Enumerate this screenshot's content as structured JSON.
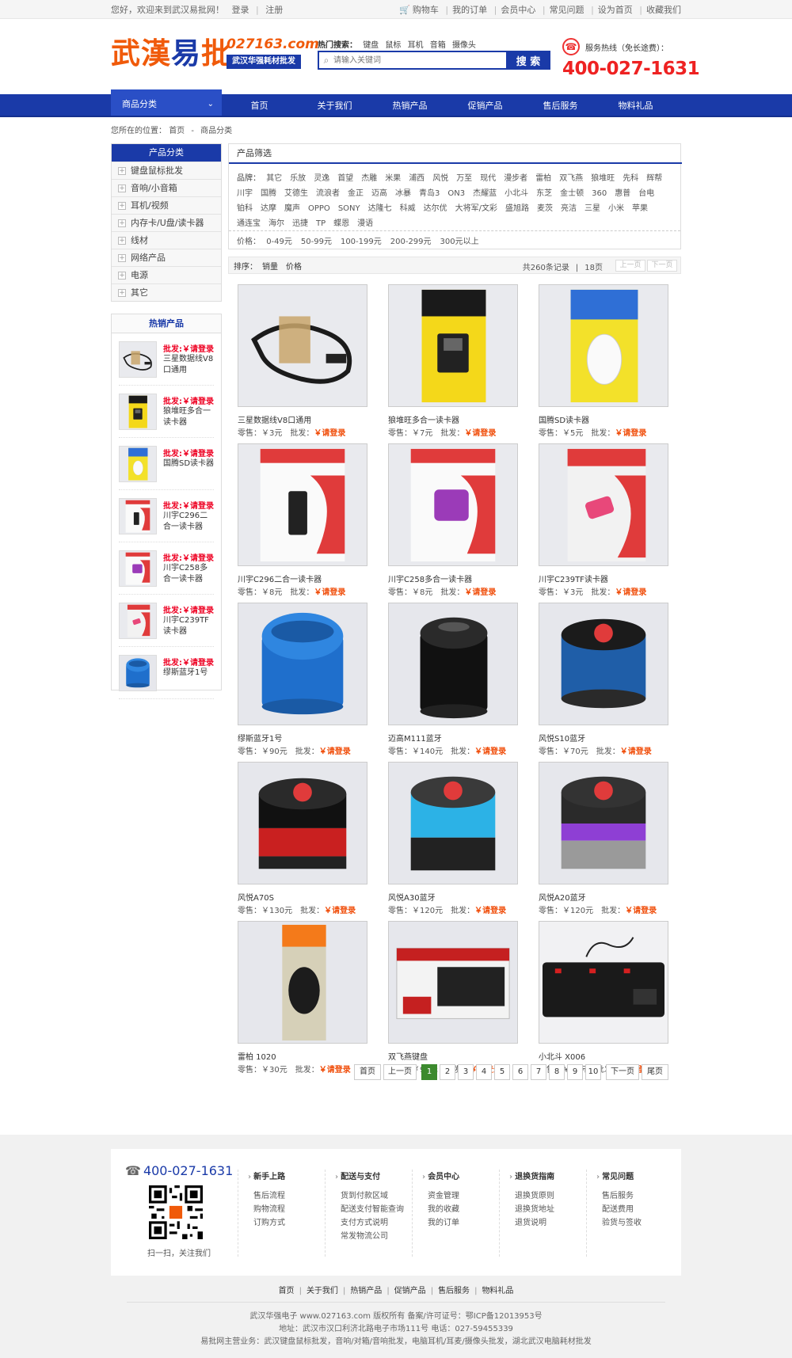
{
  "topbar": {
    "welcome": "您好，欢迎来到武汉易批网！",
    "login": "登录",
    "register": "注册",
    "links": [
      "购物车",
      "我的订单",
      "会员中心",
      "常见问题",
      "设为首页",
      "收藏我们"
    ]
  },
  "header": {
    "logo_text_a": "武漢",
    "logo_text_b": "易",
    "logo_text_c": "批",
    "logo_domain": "027163.com",
    "logo_sub": "武汉华强耗材批发",
    "hot_label": "热门搜索：",
    "hot_words": [
      "键盘",
      "鼠标",
      "耳机",
      "音箱",
      "摄像头"
    ],
    "search_placeholder": "请输入关键词",
    "search_button": "搜 索",
    "hotline_label": "服务热线（免长途费）：",
    "hotline_number": "400-027-1631"
  },
  "nav": {
    "category": "商品分类",
    "items": [
      "首页",
      "关于我们",
      "热销产品",
      "促销产品",
      "售后服务",
      "物料礼品"
    ]
  },
  "breadcrumb": {
    "label": "您所在的位置：",
    "home": "首页",
    "current": "商品分类"
  },
  "sidebar": {
    "title": "产品分类",
    "categories": [
      "键盘鼠标批发",
      "音响/小音箱",
      "耳机/视频",
      "内存卡/U盘/读卡器",
      "线材",
      "网络产品",
      "电源",
      "其它"
    ],
    "hot_title": "热销产品",
    "hot_price": "批发:￥请登录",
    "hot_items": [
      "三星数据线V8口通用",
      "狼堆旺多合一读卡器",
      "国腾SD读卡器",
      "川宇C296二合一读卡器",
      "川宇C258多合一读卡器",
      "川宇C239TF读卡器",
      "缪斯蓝牙1号"
    ]
  },
  "filter": {
    "title": "产品筛选",
    "brand_label": "品牌：",
    "brands": [
      "其它",
      "乐放",
      "灵逸",
      "首望",
      "杰雕",
      "米果",
      "浦西",
      "风悦",
      "万至",
      "现代",
      "漫步者",
      "雷柏",
      "双飞燕",
      "狼堆旺",
      "先科",
      "辉帮",
      "川宇",
      "国腾",
      "艾德生",
      "流浪者",
      "金正",
      "迈高",
      "冰暴",
      "青岛3",
      "ON3",
      "杰耀蓝",
      "小北斗",
      "东芝",
      "金士顿",
      "360",
      "惠普",
      "台电",
      "铂科",
      "达摩",
      "魔声",
      "OPPO",
      "SONY",
      "达隆七",
      "科威",
      "达尔优",
      "大将军/文彩",
      "盛旭路",
      "麦茨",
      "亮洁",
      "三星",
      "小米",
      "苹果",
      "通连宝",
      "海尔",
      "迅捷",
      "TP",
      "蝶恩",
      "漫语"
    ],
    "price_label": "价格：",
    "prices": [
      "0-49元",
      "50-99元",
      "100-199元",
      "200-299元",
      "300元以上"
    ]
  },
  "sortbar": {
    "label": "排序：",
    "options": [
      "销量",
      "价格"
    ],
    "total": "共260条记录",
    "per_page": "18页",
    "prev": "上一页",
    "next": "下一页"
  },
  "products": [
    {
      "name": "三星数据线V8口通用",
      "retail": "零售：￥3元"
    },
    {
      "name": "狼堆旺多合一读卡器",
      "retail": "零售：￥7元"
    },
    {
      "name": "国腾SD读卡器",
      "retail": "零售：￥5元"
    },
    {
      "name": "川宇C296二合一读卡器",
      "retail": "零售：￥8元"
    },
    {
      "name": "川宇C258多合一读卡器",
      "retail": "零售：￥8元"
    },
    {
      "name": "川宇C239TF读卡器",
      "retail": "零售：￥3元"
    },
    {
      "name": "缪斯蓝牙1号",
      "retail": "零售：￥90元"
    },
    {
      "name": "迈高M111蓝牙",
      "retail": "零售：￥140元"
    },
    {
      "name": "风悦S10蓝牙",
      "retail": "零售：￥70元"
    },
    {
      "name": "风悦A70S",
      "retail": "零售：￥130元"
    },
    {
      "name": "风悦A30蓝牙",
      "retail": "零售：￥120元"
    },
    {
      "name": "风悦A20蓝牙",
      "retail": "零售：￥120元"
    },
    {
      "name": "雷柏 1020",
      "retail": "零售：￥30元"
    },
    {
      "name": "双飞燕键盘",
      "retail": "零售：￥90元"
    },
    {
      "name": "小北斗 X006",
      "retail": "零售：￥30元"
    }
  ],
  "product_wholesale_label": "批发：",
  "product_wholesale_value": "￥请登录",
  "pagination": [
    "首页",
    "上一页",
    "1",
    "2",
    "3",
    "4",
    "5",
    "6",
    "7",
    "8",
    "9",
    "10",
    "下一页",
    "尾页"
  ],
  "footer": {
    "tel": "400-027-1631",
    "qr_caption": "扫一扫，关注我们",
    "columns": [
      {
        "title": "新手上路",
        "links": [
          "售后流程",
          "购物流程",
          "订购方式"
        ]
      },
      {
        "title": "配送与支付",
        "links": [
          "货到付款区域",
          "配送支付智能查询",
          "支付方式说明",
          "常发物流公司"
        ]
      },
      {
        "title": "会员中心",
        "links": [
          "资金管理",
          "我的收藏",
          "我的订单"
        ]
      },
      {
        "title": "退换货指南",
        "links": [
          "退换货原则",
          "退换货地址",
          "退货说明"
        ]
      },
      {
        "title": "常见问题",
        "links": [
          "售后服务",
          "配送费用",
          "验货与签收"
        ]
      }
    ],
    "links": [
      "首页",
      "关于我们",
      "热销产品",
      "促销产品",
      "售后服务",
      "物料礼品"
    ],
    "copyright": "武汉华强电子 www.027163.com   版权所有  备案/许可证号：鄂ICP备12013953号",
    "address": "地址：武汉市汉口利济北路电子市场111号 电话：027-59455339",
    "business": "易批网主营业务：武汉键盘鼠标批发，音响/对箱/音响批发，电脑耳机/耳麦/摄像头批发，湖北武汉电脑耗材批发"
  },
  "colors": {
    "brand_blue": "#1a3aa8",
    "accent_orange": "#f05a0a",
    "login_red": "#f04d0a"
  }
}
